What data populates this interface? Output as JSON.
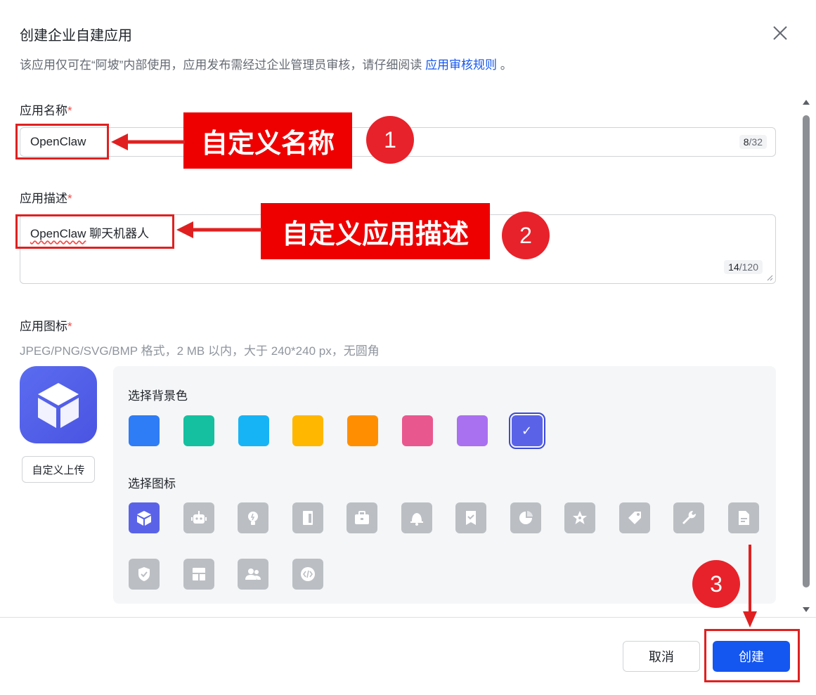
{
  "dialog": {
    "title": "创建企业自建应用",
    "subtitle_prefix": "该应用仅可在“阿坡”内部使用，应用发布需经过企业管理员审核，请仔细阅读",
    "subtitle_link": "应用审核规则",
    "subtitle_suffix": "。"
  },
  "form": {
    "name": {
      "label": "应用名称",
      "required_mark": "*",
      "value": "OpenClaw",
      "count": "8",
      "max": "/32"
    },
    "description": {
      "label": "应用描述",
      "required_mark": "*",
      "value_word": "OpenClaw",
      "value_rest": " 聊天机器人",
      "count": "14",
      "max": "/120"
    },
    "icon": {
      "label": "应用图标",
      "required_mark": "*",
      "hint": "JPEG/PNG/SVG/BMP 格式，2 MB 以内，大于 240*240 px，无圆角",
      "upload_label": "自定义上传",
      "bg_section_label": "选择背景色",
      "icon_section_label": "选择图标",
      "bg_colors": [
        "#2e7cf6",
        "#14c0a0",
        "#17b4f5",
        "#ffb700",
        "#ff8f00",
        "#e9578f",
        "#a970f0",
        "#5a63e8"
      ],
      "selected_bg_index": 7,
      "icons": [
        "cube-icon",
        "robot-icon",
        "lightbulb-icon",
        "door-icon",
        "briefcase-icon",
        "bell-icon",
        "bookmark-check-icon",
        "pie-chart-icon",
        "star-icon",
        "tag-icon",
        "wrench-icon",
        "document-icon",
        "shield-check-icon",
        "layout-icon",
        "people-icon",
        "code-icon"
      ],
      "selected_icon_index": 0
    }
  },
  "footer": {
    "cancel_label": "取消",
    "create_label": "创建"
  },
  "annotations": {
    "label_1": "自定义名称",
    "num_1": "1",
    "label_2": "自定义应用描述",
    "num_2": "2",
    "num_3": "3",
    "color": "#e02020"
  }
}
